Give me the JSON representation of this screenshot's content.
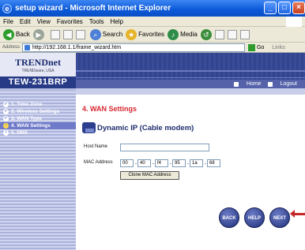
{
  "window": {
    "title": "setup wizard - Microsoft Internet Explorer"
  },
  "menubar": {
    "items": [
      "File",
      "Edit",
      "View",
      "Favorites",
      "Tools",
      "Help"
    ]
  },
  "toolbar": {
    "back": "Back",
    "search": "Search",
    "favorites": "Favorites",
    "media": "Media"
  },
  "address": {
    "label": "Address",
    "url": "http://192.168.1.1/frame_wizard.htm",
    "go": "Go",
    "links": "Links"
  },
  "brand": {
    "name": "TRENDnet",
    "tagline": "TRENDware, USA",
    "model": "TEW-231BRP"
  },
  "topnav": {
    "home": "Home",
    "logout": "Logout"
  },
  "nav": {
    "items": [
      {
        "num": "1",
        "label": "1. Time Zone"
      },
      {
        "num": "2",
        "label": "2. Wireless Settings"
      },
      {
        "num": "3",
        "label": "3. WAN Type"
      },
      {
        "num": "4",
        "label": "4. WAN Settings"
      },
      {
        "num": "5",
        "label": "5. DNS"
      }
    ]
  },
  "main": {
    "heading": "4. WAN Settings",
    "subheading": "Dynamic IP (Cable modem)",
    "host_label": "Host Name",
    "host_value": "",
    "mac_label": "MAC Address",
    "mac": [
      "00",
      "40",
      "f4",
      "95",
      "1a",
      "68"
    ],
    "clone_button": "Clone MAC Address"
  },
  "buttons": {
    "back": "BACK",
    "help": "HELP",
    "next": "NEXT"
  },
  "colors": {
    "accent_red": "#d8262f",
    "nav_blue": "#273a86"
  }
}
